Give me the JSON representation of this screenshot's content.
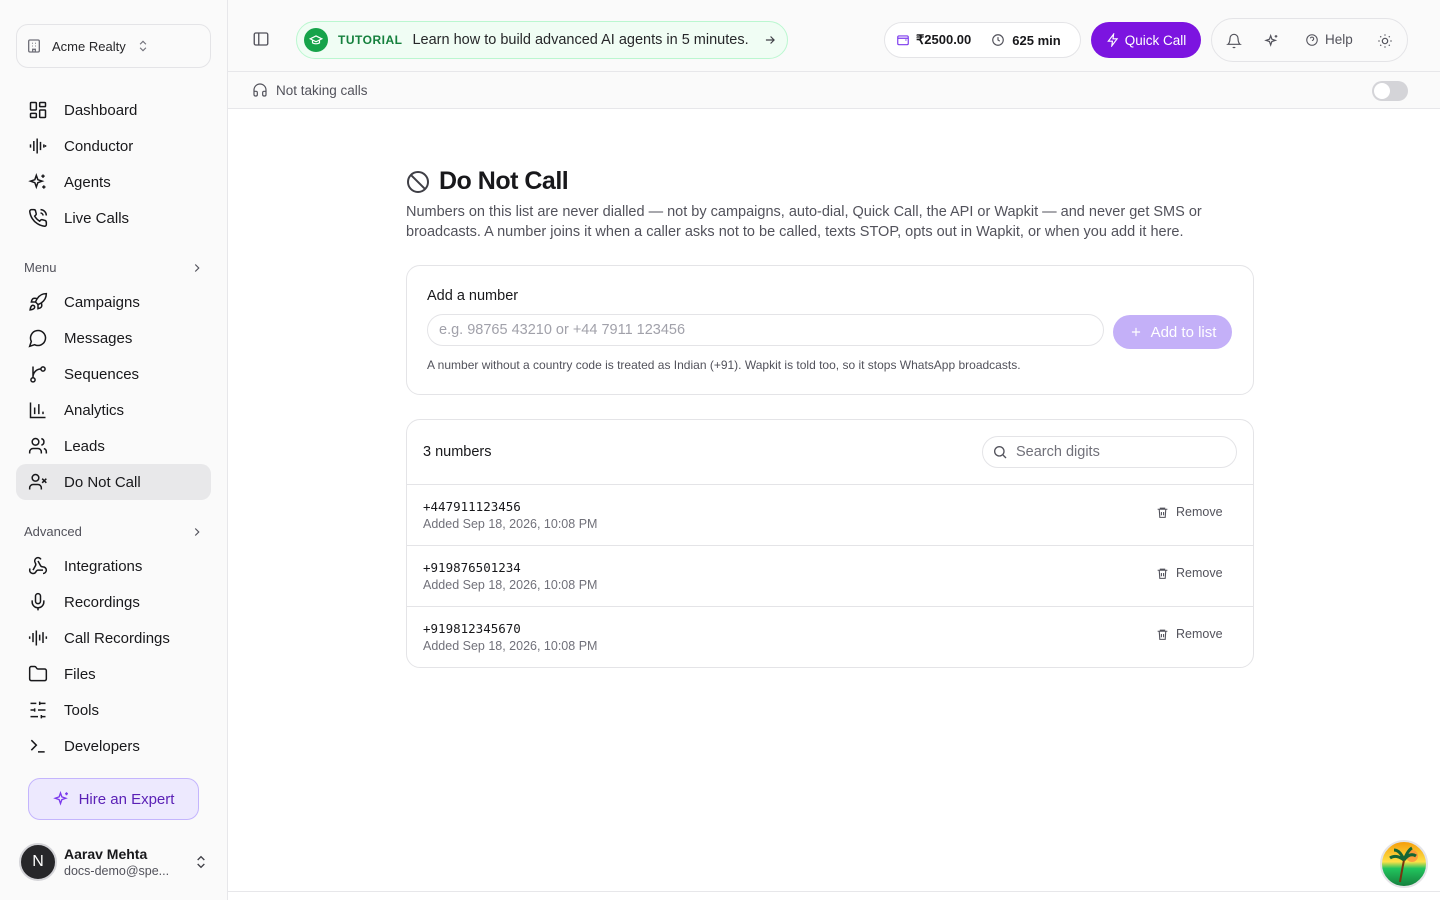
{
  "org": {
    "name": "Acme Realty"
  },
  "sidebar": {
    "top_items": [
      {
        "label": "Dashboard",
        "icon": "dashboard-icon"
      },
      {
        "label": "Conductor",
        "icon": "waveform-icon"
      },
      {
        "label": "Agents",
        "icon": "sparkles-icon"
      },
      {
        "label": "Live Calls",
        "icon": "phone-call-icon"
      }
    ],
    "menu_label": "Menu",
    "menu_items": [
      {
        "label": "Campaigns",
        "icon": "rocket-icon"
      },
      {
        "label": "Messages",
        "icon": "message-circle-icon"
      },
      {
        "label": "Sequences",
        "icon": "git-branch-icon"
      },
      {
        "label": "Analytics",
        "icon": "bar-chart-icon"
      },
      {
        "label": "Leads",
        "icon": "users-icon"
      },
      {
        "label": "Do Not Call",
        "icon": "user-x-icon",
        "active": true
      }
    ],
    "advanced_label": "Advanced",
    "advanced_items": [
      {
        "label": "Integrations",
        "icon": "webhook-icon"
      },
      {
        "label": "Recordings",
        "icon": "microphone-icon"
      },
      {
        "label": "Call Recordings",
        "icon": "audio-lines-icon"
      },
      {
        "label": "Files",
        "icon": "folder-icon"
      },
      {
        "label": "Tools",
        "icon": "sliders-icon"
      },
      {
        "label": "Developers",
        "icon": "terminal-icon"
      }
    ],
    "hire_label": "Hire an Expert",
    "user": {
      "initial": "N",
      "name": "Aarav Mehta",
      "email": "docs-demo@spe..."
    }
  },
  "topbar": {
    "tutorial_tag": "TUTORIAL",
    "tutorial_text": "Learn how to build advanced AI agents in 5 minutes.",
    "balance": "₹2500.00",
    "minutes": "625 min",
    "quick_call": "Quick Call",
    "help": "Help"
  },
  "status": {
    "text": "Not taking calls"
  },
  "page": {
    "title": "Do Not Call",
    "description": "Numbers on this list are never dialled — not by campaigns, auto-dial, Quick Call, the API or Wapkit — and never get SMS or broadcasts. A number joins it when a caller asks not to be called, texts STOP, opts out in Wapkit, or when you add it here.",
    "add_label": "Add a number",
    "add_placeholder": "e.g. 98765 43210 or +44 7911 123456",
    "add_button": "Add to list",
    "hint": "A number without a country code is treated as Indian (+91). Wapkit is told too, so it stops WhatsApp broadcasts.",
    "count_label": "3 numbers",
    "search_placeholder": "Search digits",
    "remove_label": "Remove",
    "numbers": [
      {
        "number": "+447911123456",
        "added": "Added Sep 18, 2026, 10:08 PM"
      },
      {
        "number": "+919876501234",
        "added": "Added Sep 18, 2026, 10:08 PM"
      },
      {
        "number": "+919812345670",
        "added": "Added Sep 18, 2026, 10:08 PM"
      }
    ]
  },
  "colors": {
    "accent": "#7c14e0",
    "tutorial_green": "#16a34a",
    "active_bg": "#e8e8ea"
  }
}
